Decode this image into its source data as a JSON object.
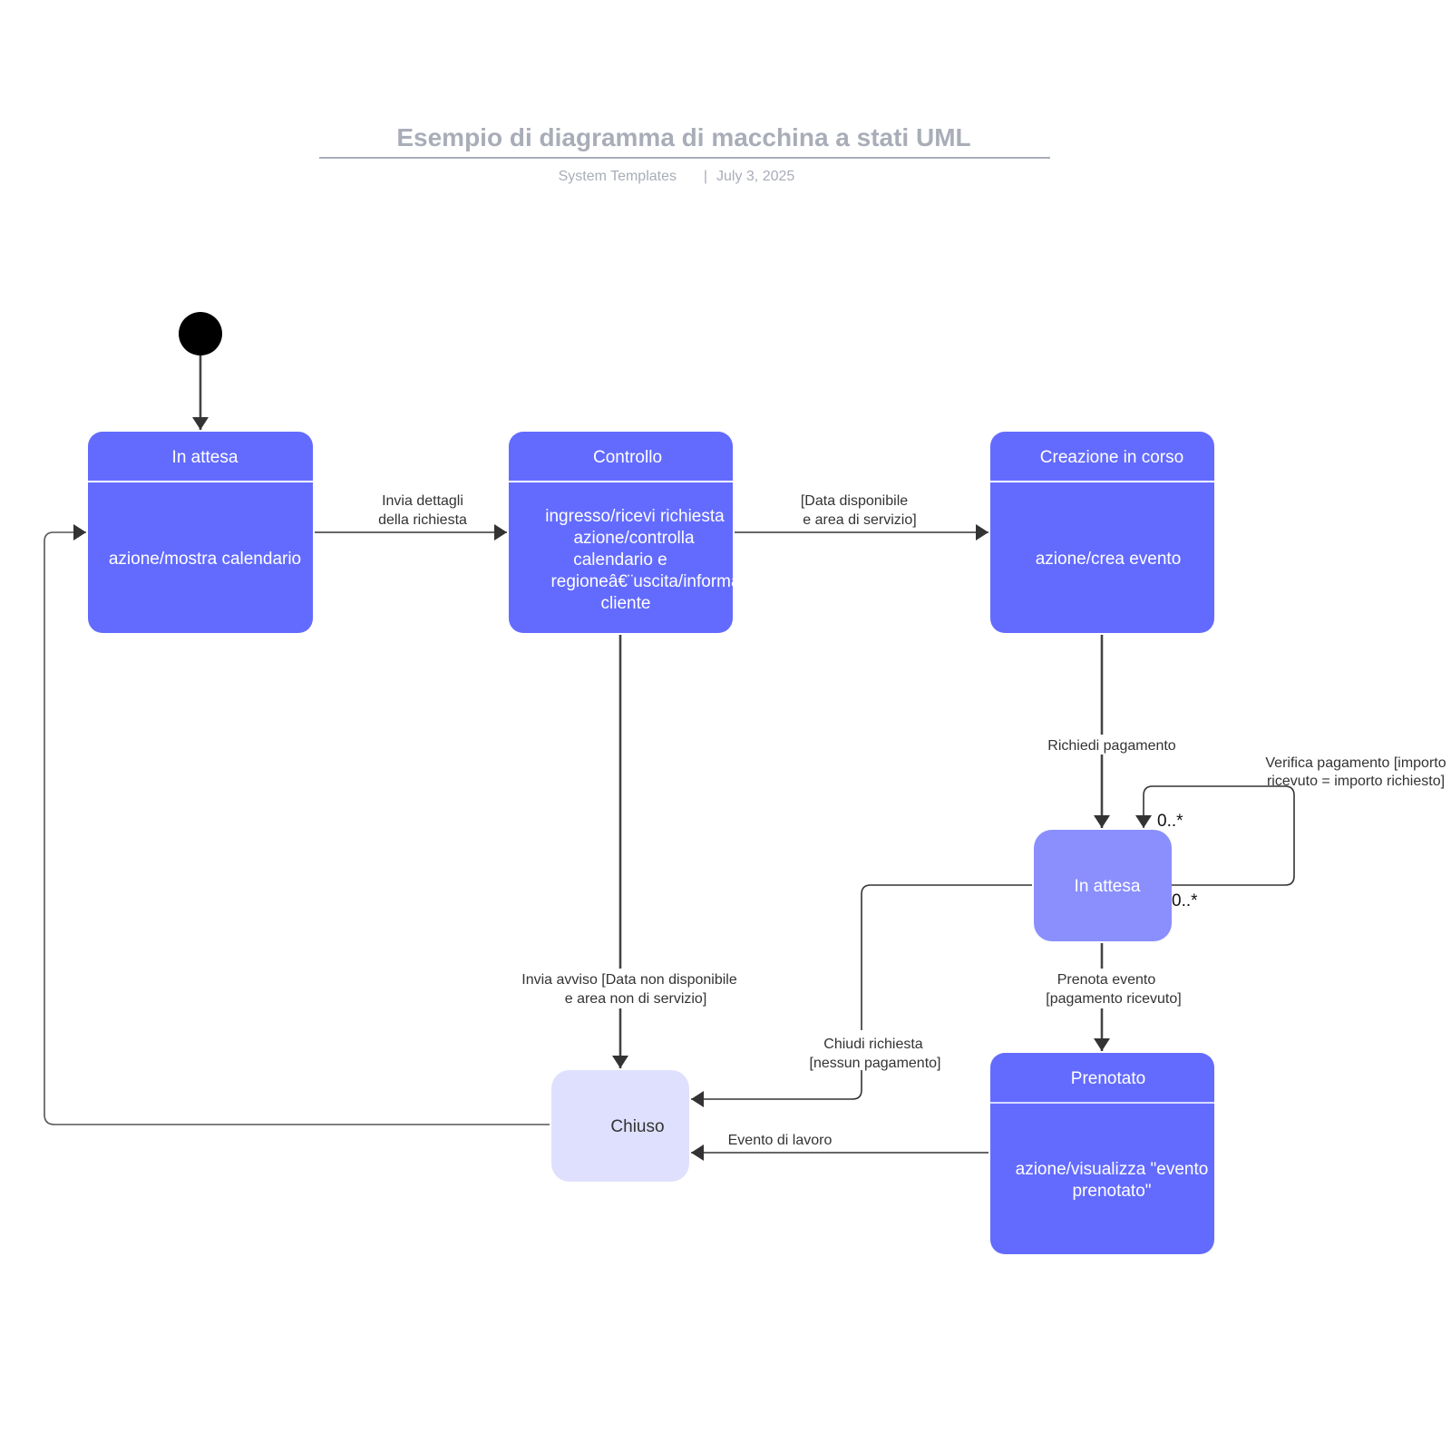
{
  "header": {
    "title": "Esempio di diagramma di macchina a stati UML",
    "source": "System Templates",
    "separator": "|",
    "date": "July 3, 2025"
  },
  "colors": {
    "state_fill": "#636bff",
    "state_light_fill": "#8a8ffd",
    "state_final_fill": "#dfe0fd",
    "line": "#333333",
    "title_grey": "#a9adb8"
  },
  "states": {
    "waiting": {
      "title": "In attesa",
      "body": [
        "azione/mostra calendario"
      ]
    },
    "check": {
      "title": "Controllo",
      "body": [
        "ingresso/ricevi richiesta",
        "azione/controlla",
        "calendario e",
        "regioneâ€¨uscita/informa",
        "cliente"
      ]
    },
    "creating": {
      "title": "Creazione in corso",
      "body": [
        "azione/crea evento"
      ]
    },
    "payment_wait": {
      "title": "In attesa"
    },
    "booked": {
      "title": "Prenotato",
      "body": [
        "azione/visualizza \"evento",
        "prenotato\""
      ]
    },
    "closed": {
      "title": "Chiuso"
    }
  },
  "transitions": {
    "send_details": [
      "Invia dettagli",
      "della richiesta"
    ],
    "date_available": [
      "[Data disponibile",
      "e area di servizio]"
    ],
    "request_payment": [
      "Richiedi pagamento"
    ],
    "verify_payment": [
      "Verifica pagamento [importo",
      "ricevuto = importo richiesto]"
    ],
    "send_notice": [
      "Invia avviso [Data non disponibile",
      "e area non di servizio]"
    ],
    "book_event": [
      "Prenota evento",
      "[pagamento ricevuto]"
    ],
    "close_request": [
      "Chiudi richiesta",
      "[nessun pagamento]"
    ],
    "work_event": [
      "Evento di lavoro"
    ]
  },
  "multiplicities": {
    "self_loop_in": "0..*",
    "self_loop_out": "0..*"
  }
}
